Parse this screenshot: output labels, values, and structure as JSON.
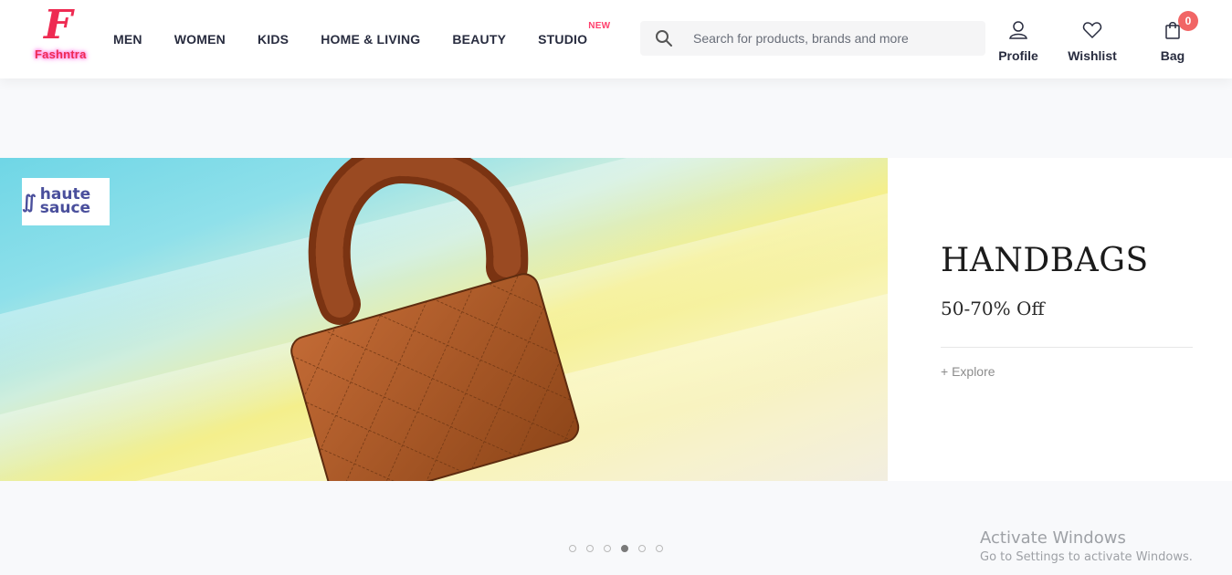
{
  "brand": {
    "logo_letter": "F",
    "logo_text": "Fashntra"
  },
  "nav": {
    "items": [
      {
        "label": "MEN"
      },
      {
        "label": "WOMEN"
      },
      {
        "label": "KIDS"
      },
      {
        "label": "HOME & LIVING"
      },
      {
        "label": "BEAUTY"
      },
      {
        "label": "STUDIO",
        "badge": "NEW"
      }
    ]
  },
  "search": {
    "placeholder": "Search for products, brands and more",
    "value": ""
  },
  "actions": {
    "profile_label": "Profile",
    "wishlist_label": "Wishlist",
    "bag_label": "Bag",
    "bag_count": "0"
  },
  "banner": {
    "brand_badge": "haute sauce",
    "headline": "HANDBAGS",
    "discount": "50-70% Off",
    "cta": "+ Explore"
  },
  "carousel": {
    "total": 6,
    "active_index": 3
  },
  "watermark": {
    "title": "Activate Windows",
    "subtitle": "Go to Settings to activate Windows."
  },
  "colors": {
    "accent": "#ff3f6c",
    "logo": "#ee2b52",
    "bag_badge": "#f16565",
    "text_primary": "#282c3f"
  },
  "icons": [
    "search-icon",
    "profile-icon",
    "heart-icon",
    "bag-icon"
  ]
}
